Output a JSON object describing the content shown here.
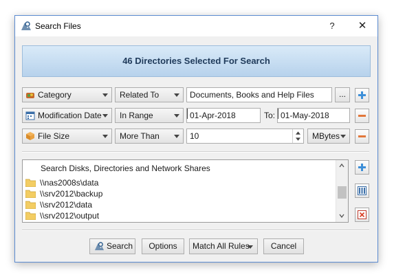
{
  "window": {
    "title": "Search Files",
    "help": "?",
    "close": "✕"
  },
  "banner": "46 Directories Selected For Search",
  "rules": [
    {
      "field": "Category",
      "operator": "Related To",
      "value": "Documents, Books and Help Files",
      "browse": "..."
    },
    {
      "field": "Modification Date",
      "operator": "In Range",
      "from": "01-Apr-2018",
      "to_label": "To:",
      "to": "01-May-2018"
    },
    {
      "field": "File Size",
      "operator": "More Than",
      "value": "10",
      "unit": "MBytes"
    }
  ],
  "locations": {
    "header": "Search Disks, Directories and Network Shares",
    "items": [
      "\\\\nas2008s\\data",
      "\\\\srv2012\\backup",
      "\\\\srv2012\\data",
      "\\\\srv2012\\output"
    ]
  },
  "buttons": {
    "search": "Search",
    "options": "Options",
    "match": "Match All Rules",
    "cancel": "Cancel"
  },
  "colors": {
    "accent_blue": "#3d8fd8",
    "remove_orange": "#e2773a",
    "banner_text": "#1f3a5a"
  }
}
